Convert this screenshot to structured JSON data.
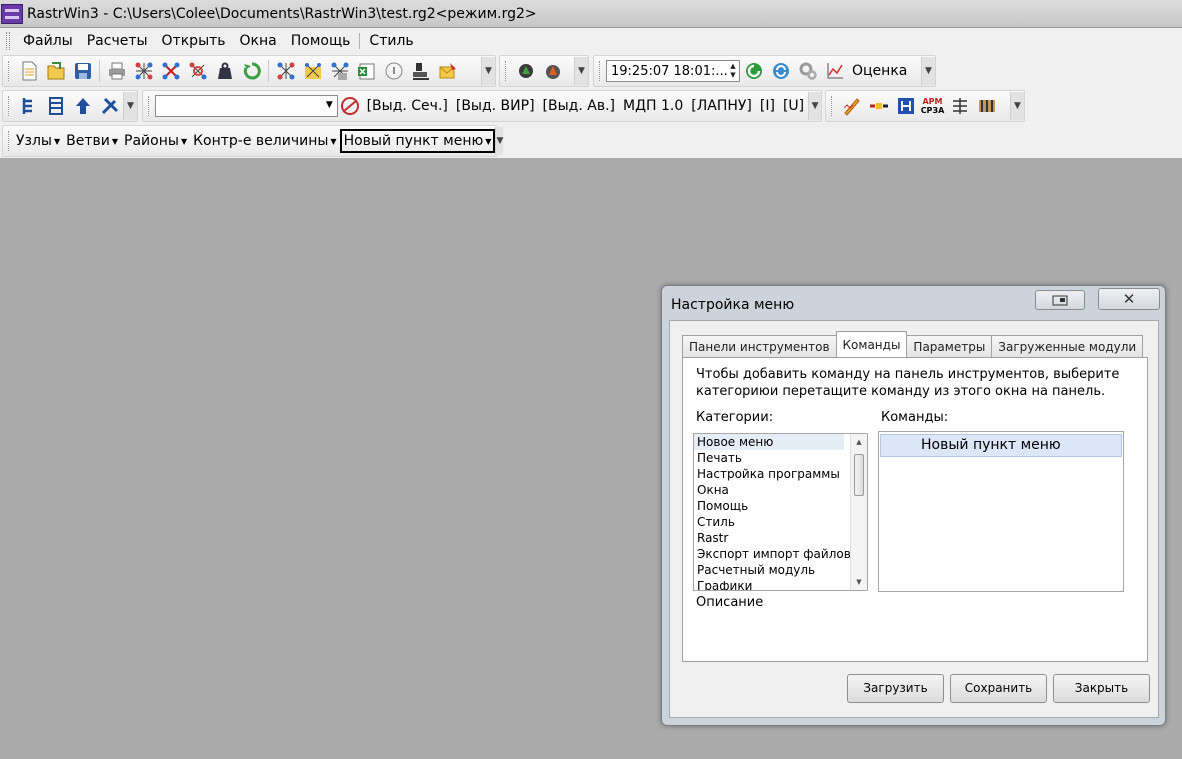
{
  "window": {
    "title": "RastrWin3 - C:\\Users\\Colee\\Documents\\RastrWin3\\test.rg2<режим.rg2>"
  },
  "menubar": {
    "items": [
      "Файлы",
      "Расчеты",
      "Открыть",
      "Окна",
      "Помощь",
      "Стиль"
    ]
  },
  "toolbar1": {
    "time_value": "19:25:07  18:01:...",
    "assess_label": "Оценка"
  },
  "toolbar2": {
    "combo_value": "",
    "buttons": [
      "[Выд. Сеч.]",
      "[Выд. ВИР]",
      "[Выд. Ав.]",
      "МДП 1.0",
      "[ЛАПНУ]",
      "[I]",
      "[U]"
    ],
    "arm_label_top": "АРМ",
    "arm_label_bottom": "СРЗА"
  },
  "toolbar3": {
    "items": [
      "Узлы",
      "Ветви",
      "Районы",
      "Контр-е величины",
      "Новый пункт меню"
    ]
  },
  "dialog": {
    "title": "Настройка меню",
    "tabs": [
      "Панели инструментов",
      "Команды",
      "Параметры",
      "Загруженные модули"
    ],
    "active_tab": "Команды",
    "hint": "Чтобы добавить команду на панель инструментов, выберите категориюи перетащите команду из этого окна на панель.",
    "categories_label": "Категории:",
    "commands_label": "Команды:",
    "categories": [
      "Новое меню",
      "Печать",
      "Настройка программы",
      "Окна",
      "Помощь",
      "Стиль",
      "Rastr",
      "Экспорт импорт файлов",
      "Расчетный модуль",
      "Графики"
    ],
    "commands": [
      "Новый пункт меню"
    ],
    "description_label": "Описание",
    "buttons": {
      "load": "Загрузить",
      "save": "Сохранить",
      "close": "Закрыть"
    }
  },
  "colors": {
    "desktop": "#ababab",
    "dialog_frame": "#cdd3db",
    "selection": "#dbe6f7"
  }
}
